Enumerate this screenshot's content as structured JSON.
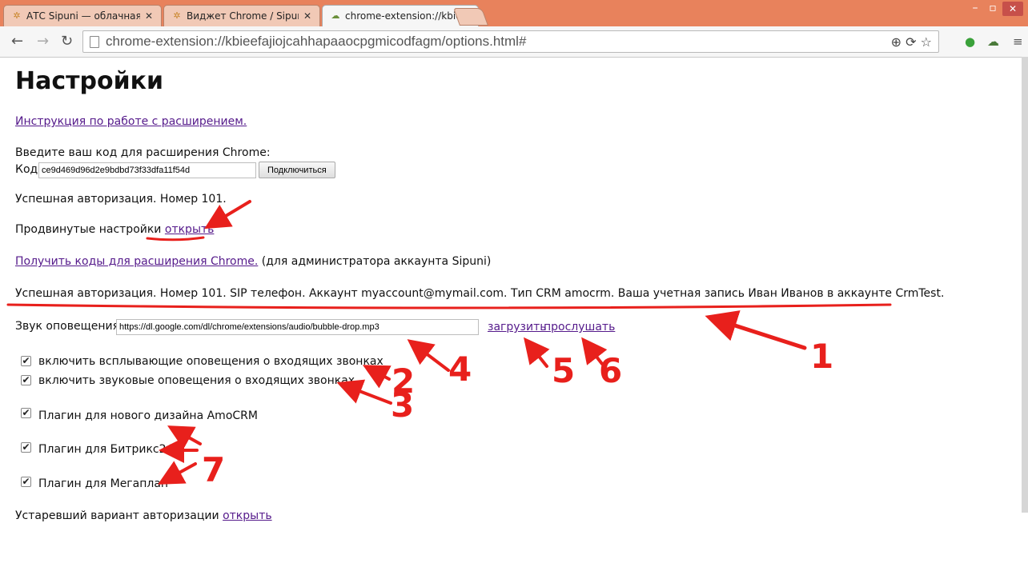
{
  "browser": {
    "tabs": [
      {
        "title": "АТС Sipuni — облачная",
        "icon": "sipuni-icon",
        "active": false
      },
      {
        "title": "Виджет Chrome / Sipuni.",
        "icon": "sipuni-icon",
        "active": false
      },
      {
        "title": "chrome-extension://kbiee",
        "icon": "extension-icon",
        "active": true
      }
    ],
    "address": "chrome-extension://kbieefajiojcahhapaaocpgmicodfagm/options.html#"
  },
  "page": {
    "title": "Настройки",
    "instructions_link": "Инструкция по работе с расширением.",
    "code_prompt": "Введите ваш код для расширения Chrome:",
    "code_label": "Код",
    "code_value": "ce9d469d96d2e9bdbd73f33dfa11f54d",
    "connect_button": "Подключиться",
    "auth_status_short": "Успешная авторизация. Номер 101.",
    "advanced_label": "Продвинутые настройки",
    "advanced_link": "открыть",
    "get_codes_link": "Получить коды для расширения Chrome.",
    "get_codes_note": "(для администратора аккаунта Sipuni)",
    "auth_status_full": "Успешная авторизация. Номер 101. SIP телефон. Аккаунт myaccount@mymail.com. Тип CRM amocrm. Ваша учетная запись Иван Иванов в аккаунте CrmTest.",
    "sound_label": "Звук оповещения",
    "sound_value": "https://dl.google.com/dl/chrome/extensions/audio/bubble-drop.mp3",
    "upload_link": "загрузить",
    "listen_link": "прослушать",
    "checkboxes": [
      {
        "label": "включить всплывающие оповещения о входящих звонках",
        "checked": true
      },
      {
        "label": "включить звуковые оповещения о входящих звонках",
        "checked": true
      },
      {
        "label": "Плагин для нового дизайна AmoCRM",
        "checked": true
      },
      {
        "label": "Плагин для Битрикс24",
        "checked": true
      },
      {
        "label": "Плагин для Мегаплан",
        "checked": true
      }
    ],
    "legacy_label": "Устаревший вариант авторизации",
    "legacy_link": "открыть"
  },
  "annotations": {
    "numbers": [
      "1",
      "2",
      "3",
      "4",
      "5",
      "6",
      "7"
    ],
    "color": "#e8201c"
  }
}
